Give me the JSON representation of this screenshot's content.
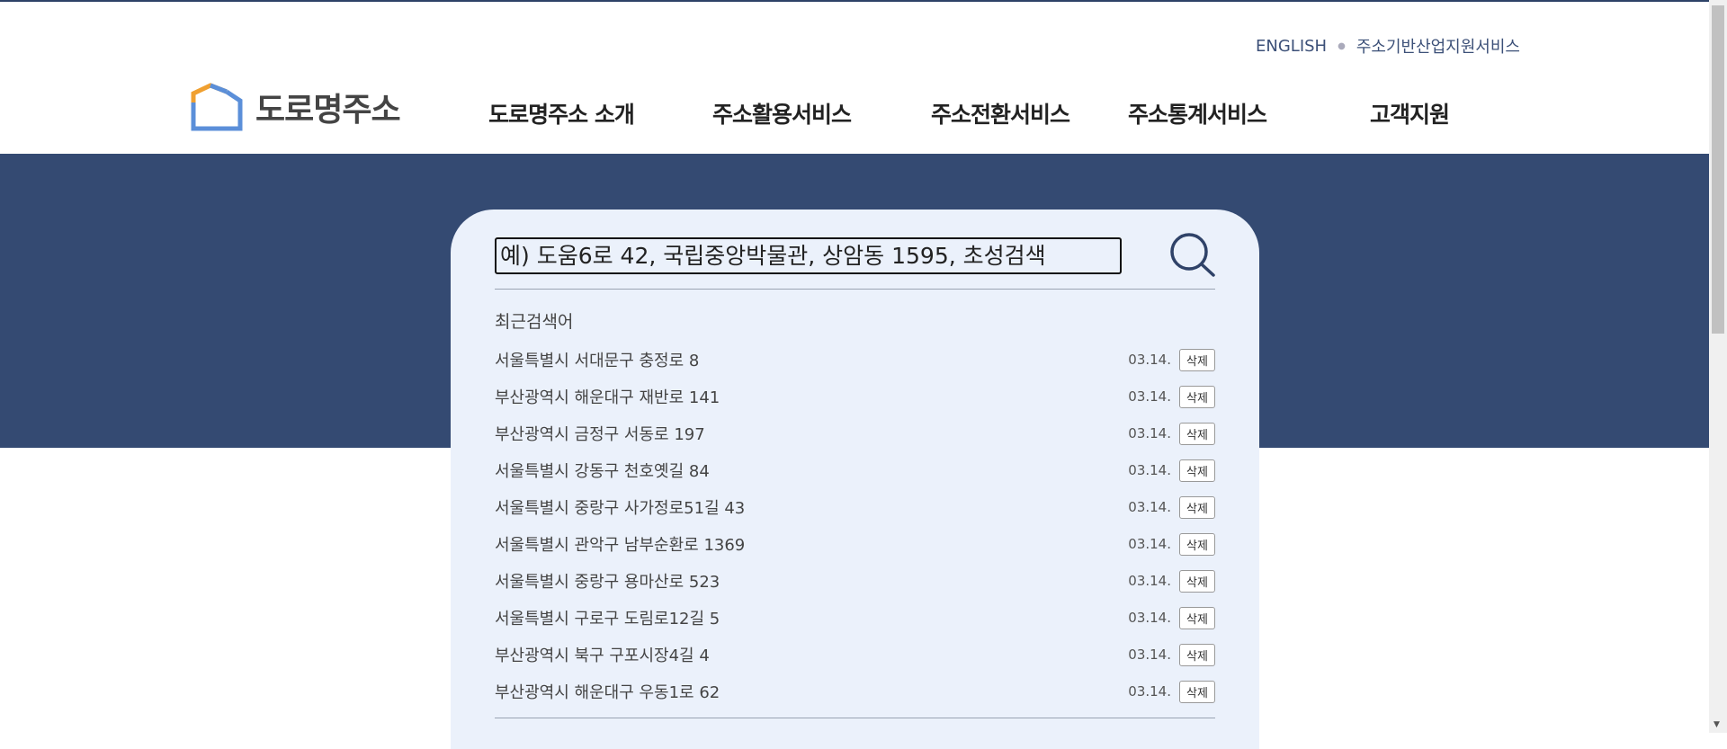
{
  "header": {
    "util_links": [
      "ENGLISH",
      "주소기반산업지원서비스"
    ],
    "logo_text": "도로명주소",
    "nav": [
      "도로명주소 소개",
      "주소활용서비스",
      "주소전환서비스",
      "주소통계서비스",
      "고객지원"
    ]
  },
  "search": {
    "placeholder": "예) 도움6로 42, 국립중앙박물관, 상암동 1595, 초성검색",
    "recent_title": "최근검색어",
    "delete_label": "삭제",
    "recent": [
      {
        "address": "서울특별시 서대문구 충정로 8",
        "date": "03.14."
      },
      {
        "address": "부산광역시 해운대구 재반로 141",
        "date": "03.14."
      },
      {
        "address": "부산광역시 금정구 서동로 197",
        "date": "03.14."
      },
      {
        "address": "서울특별시 강동구 천호옛길 84",
        "date": "03.14."
      },
      {
        "address": "서울특별시 중랑구 사가정로51길 43",
        "date": "03.14."
      },
      {
        "address": "서울특별시 관악구 남부순환로 1369",
        "date": "03.14."
      },
      {
        "address": "서울특별시 중랑구 용마산로 523",
        "date": "03.14."
      },
      {
        "address": "서울특별시 구로구 도림로12길 5",
        "date": "03.14."
      },
      {
        "address": "부산광역시 북구 구포시장4길 4",
        "date": "03.14."
      },
      {
        "address": "부산광역시 해운대구 우동1로 62",
        "date": "03.14."
      }
    ]
  },
  "colors": {
    "band": "#344a72",
    "panel": "#ebf1fb",
    "logo_orange": "#f0a030",
    "logo_blue": "#5b8fd9"
  }
}
